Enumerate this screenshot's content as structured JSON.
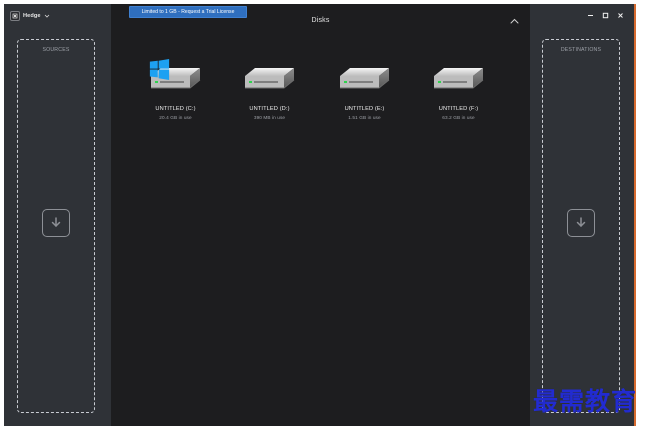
{
  "app": {
    "name": "Hedge"
  },
  "banner": {
    "text": "Limited to 1 GB - Request a Trial License"
  },
  "main": {
    "title": "Disks"
  },
  "panels": {
    "left_title": "SOURCES",
    "right_title": "DESTINATIONS"
  },
  "disks": [
    {
      "name": "UNTITLED (C:)",
      "usage": "20.4 GB in use",
      "icon": "system-drive-icon"
    },
    {
      "name": "UNTITLED (D:)",
      "usage": "390 MB in use",
      "icon": "drive-icon"
    },
    {
      "name": "UNTITLED (E:)",
      "usage": "1.51 GB in use",
      "icon": "drive-icon"
    },
    {
      "name": "UNTITLED (F:)",
      "usage": "63.2 GB in use",
      "icon": "drive-icon"
    }
  ],
  "watermark": {
    "text": "最需教育"
  },
  "colors": {
    "banner": "#2f6fbf",
    "panel": "#2f3237",
    "main": "#1d1d1f",
    "accent_border": "#d66a2f",
    "windows_blue": "#1da1f2"
  }
}
